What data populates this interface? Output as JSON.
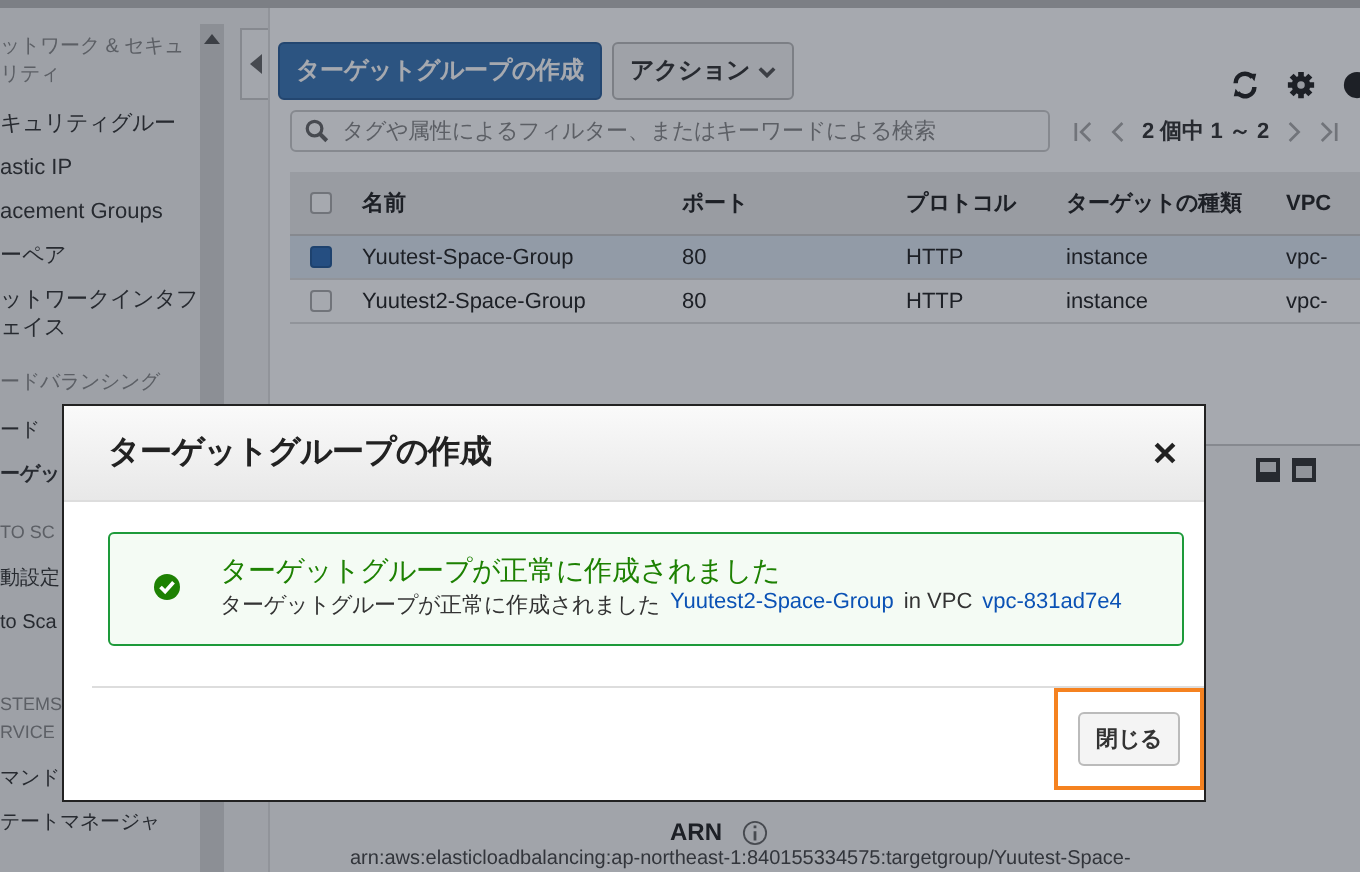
{
  "sidebar": {
    "items": [
      {
        "kind": "header",
        "label": "ットワーク & セキュリティ",
        "selected": false
      },
      {
        "kind": "link",
        "label": "キュリティグルー",
        "selected": false
      },
      {
        "kind": "link",
        "label": "astic IP",
        "selected": false
      },
      {
        "kind": "link",
        "label": "acement Groups",
        "selected": false
      },
      {
        "kind": "link",
        "label": "ーペア",
        "selected": false
      },
      {
        "kind": "link",
        "label": "ットワークインタフェイス",
        "selected": false
      },
      {
        "kind": "header",
        "label": "ードバランシング",
        "selected": false
      },
      {
        "kind": "link",
        "label": "ード",
        "selected": false
      },
      {
        "kind": "link",
        "label": "ーゲッ",
        "selected": true
      },
      {
        "kind": "header",
        "label": "TO SC",
        "selected": false
      },
      {
        "kind": "link",
        "label": "動設定",
        "selected": false
      },
      {
        "kind": "link",
        "label": "to Sca",
        "selected": false
      },
      {
        "kind": "header",
        "label": "STEMS",
        "selected": false
      },
      {
        "kind": "header",
        "label": "RVICE",
        "selected": false
      },
      {
        "kind": "link",
        "label": "マンド",
        "selected": false
      },
      {
        "kind": "link",
        "label": "テートマネージャ",
        "selected": false
      }
    ]
  },
  "toolbar": {
    "create_button": "ターゲットグループの作成",
    "actions_button": "アクション"
  },
  "search": {
    "placeholder": "タグや属性によるフィルター、またはキーワードによる検索"
  },
  "pagination": {
    "label": "2 個中 1 ～ 2"
  },
  "table": {
    "all_selected": false,
    "columns": [
      "名前",
      "ポート",
      "プロトコル",
      "ターゲットの種類",
      "VPC"
    ],
    "rows": [
      {
        "selected": true,
        "cells": [
          "Yuutest-Space-Group",
          "80",
          "HTTP",
          "instance",
          "vpc-"
        ]
      },
      {
        "selected": false,
        "cells": [
          "Yuutest2-Space-Group",
          "80",
          "HTTP",
          "instance",
          "vpc-"
        ]
      }
    ]
  },
  "details": {
    "arn_label": "ARN",
    "arn_value": "arn:aws:elasticloadbalancing:ap-northeast-1:840155334575:targetgroup/Yuutest-Space-"
  },
  "dialog": {
    "title": "ターゲットグループの作成",
    "alert": {
      "title": "ターゲットグループが正常に作成されました",
      "text": "ターゲットグループが正常に作成されました",
      "link": "Yuutest2-Space-Group",
      "middle": "in VPC",
      "vpc_link": "vpc-831ad7e4"
    },
    "close_button": "閉じる",
    "close_button_highlighted": true
  }
}
